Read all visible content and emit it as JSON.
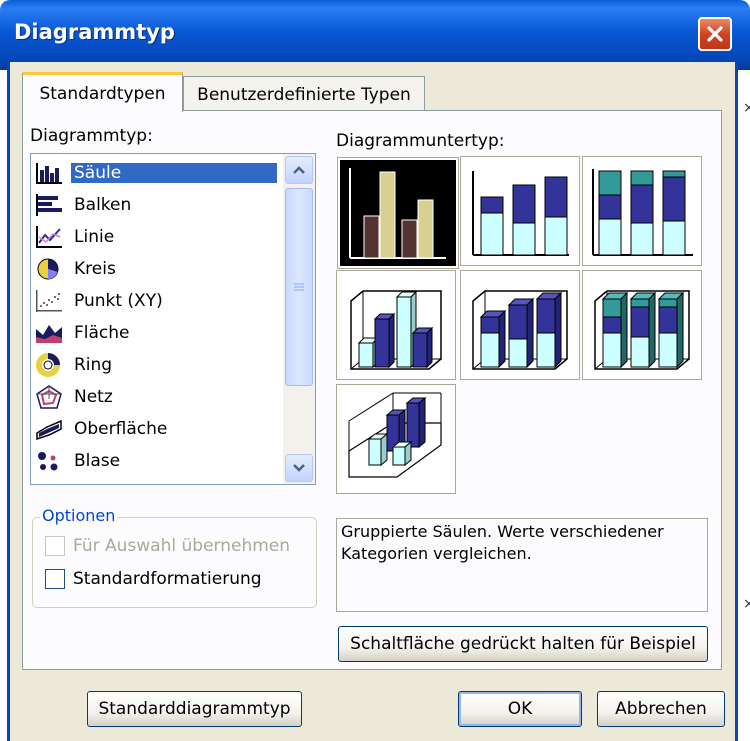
{
  "window": {
    "title": "Diagrammtyp"
  },
  "tabs": [
    {
      "label": "Standardtypen",
      "active": true
    },
    {
      "label": "Benutzerdefinierte Typen",
      "active": false
    }
  ],
  "chart_type_label": "Diagrammtyp:",
  "chart_types": [
    {
      "label": "Säule",
      "icon": "column-chart-icon",
      "selected": true
    },
    {
      "label": "Balken",
      "icon": "bar-chart-icon"
    },
    {
      "label": "Linie",
      "icon": "line-chart-icon"
    },
    {
      "label": "Kreis",
      "icon": "pie-chart-icon"
    },
    {
      "label": "Punkt (XY)",
      "icon": "scatter-chart-icon"
    },
    {
      "label": "Fläche",
      "icon": "area-chart-icon"
    },
    {
      "label": "Ring",
      "icon": "doughnut-chart-icon"
    },
    {
      "label": "Netz",
      "icon": "radar-chart-icon"
    },
    {
      "label": "Oberfläche",
      "icon": "surface-chart-icon"
    },
    {
      "label": "Blase",
      "icon": "bubble-chart-icon"
    }
  ],
  "subtype_label": "Diagrammuntertyp:",
  "subtypes": [
    {
      "name": "clustered-column",
      "selected": true
    },
    {
      "name": "stacked-column"
    },
    {
      "name": "100-percent-stacked-column"
    },
    {
      "name": "3d-clustered-column"
    },
    {
      "name": "3d-stacked-column"
    },
    {
      "name": "3d-100-percent-stacked-column"
    },
    {
      "name": "3d-column"
    }
  ],
  "options": {
    "title": "Optionen",
    "apply_to_selection": {
      "label": "Für Auswahl übernehmen",
      "checked": false,
      "enabled": false
    },
    "default_formatting": {
      "label": "Standardformatierung",
      "checked": false,
      "enabled": true
    }
  },
  "description": "Gruppierte Säulen. Werte verschiedener Kategorien vergleichen.",
  "buttons": {
    "preview": "Schaltfläche gedrückt halten für Beispiel",
    "set_default": "Standarddiagrammtyp",
    "ok": "OK",
    "cancel": "Abbrechen"
  },
  "colors": {
    "titlebar": "#0858d6",
    "dialog_bg": "#ece9d8",
    "selection": "#316ac5",
    "chart_navy": "#333399",
    "chart_light": "#ccffff",
    "chart_teal": "#339999"
  }
}
